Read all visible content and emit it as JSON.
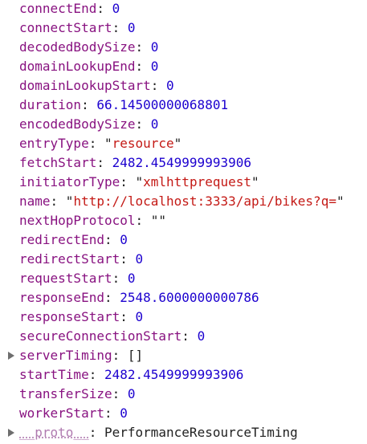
{
  "properties": [
    {
      "key": "connectEnd",
      "type": "number",
      "value": "0"
    },
    {
      "key": "connectStart",
      "type": "number",
      "value": "0"
    },
    {
      "key": "decodedBodySize",
      "type": "number",
      "value": "0"
    },
    {
      "key": "domainLookupEnd",
      "type": "number",
      "value": "0"
    },
    {
      "key": "domainLookupStart",
      "type": "number",
      "value": "0"
    },
    {
      "key": "duration",
      "type": "number",
      "value": "66.14500000068801"
    },
    {
      "key": "encodedBodySize",
      "type": "number",
      "value": "0"
    },
    {
      "key": "entryType",
      "type": "string",
      "value": "resource"
    },
    {
      "key": "fetchStart",
      "type": "number",
      "value": "2482.4549999993906"
    },
    {
      "key": "initiatorType",
      "type": "string",
      "value": "xmlhttprequest"
    },
    {
      "key": "name",
      "type": "string",
      "value": "http://localhost:3333/api/bikes?q="
    },
    {
      "key": "nextHopProtocol",
      "type": "string",
      "value": ""
    },
    {
      "key": "redirectEnd",
      "type": "number",
      "value": "0"
    },
    {
      "key": "redirectStart",
      "type": "number",
      "value": "0"
    },
    {
      "key": "requestStart",
      "type": "number",
      "value": "0"
    },
    {
      "key": "responseEnd",
      "type": "number",
      "value": "2548.6000000000786"
    },
    {
      "key": "responseStart",
      "type": "number",
      "value": "0"
    },
    {
      "key": "secureConnectionStart",
      "type": "number",
      "value": "0"
    },
    {
      "key": "serverTiming",
      "type": "array",
      "value": "[]"
    },
    {
      "key": "startTime",
      "type": "number",
      "value": "2482.4549999993906"
    },
    {
      "key": "transferSize",
      "type": "number",
      "value": "0"
    },
    {
      "key": "workerStart",
      "type": "number",
      "value": "0"
    },
    {
      "key": "__proto__",
      "type": "object",
      "value": "PerformanceResourceTiming"
    }
  ],
  "separator": ": ",
  "quote_char": "\"",
  "colors": {
    "key": "#881280",
    "proto_key": "#b07bb0",
    "number": "#1c00cf",
    "string": "#c41a16",
    "toggle_arrow": "#6e6e6e"
  },
  "icons": {
    "expand": "expand-triangle-icon"
  }
}
